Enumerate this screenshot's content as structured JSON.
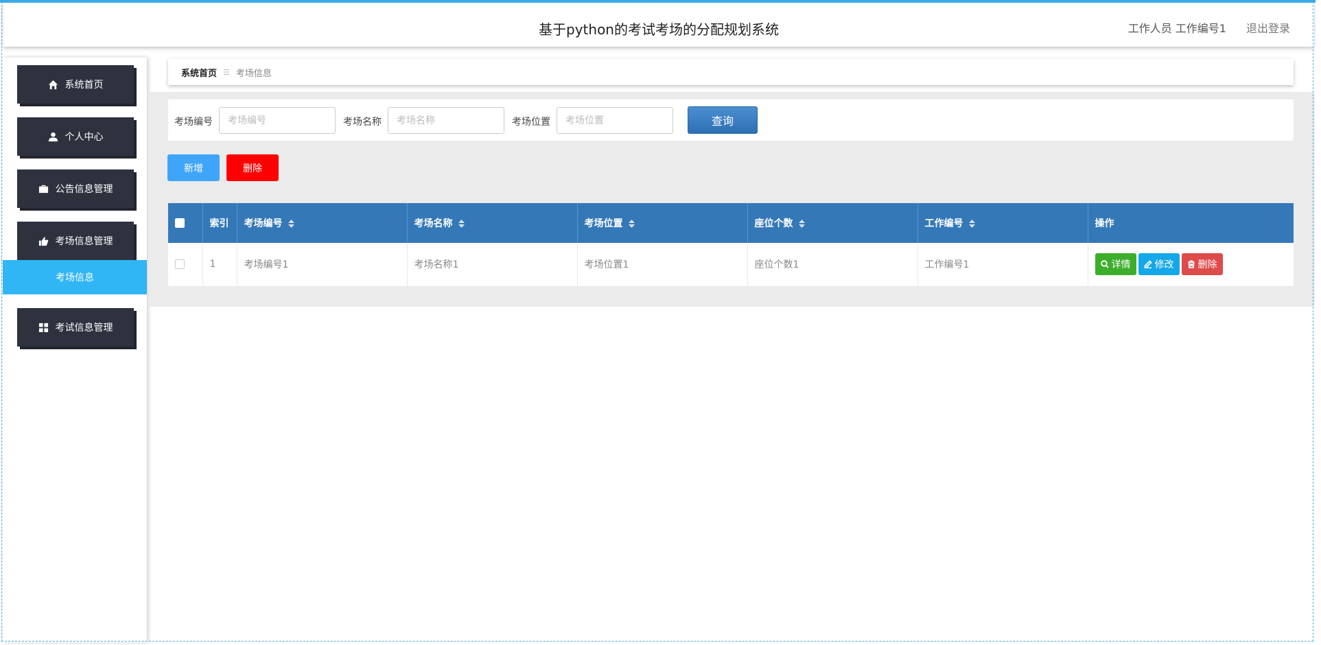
{
  "header": {
    "title": "基于python的考试考场的分配规划系统",
    "user": "工作人员 工作编号1",
    "logout": "退出登录"
  },
  "sidebar": {
    "items": [
      {
        "label": "系统首页",
        "icon": "home-icon"
      },
      {
        "label": "个人中心",
        "icon": "user-icon"
      },
      {
        "label": "公告信息管理",
        "icon": "briefcase-icon"
      },
      {
        "label": "考场信息管理",
        "icon": "hand-icon"
      },
      {
        "label": "考试信息管理",
        "icon": "grid-icon"
      }
    ],
    "active_sub": "考场信息"
  },
  "breadcrumb": {
    "home": "系统首页",
    "separator": "☰",
    "current": "考场信息"
  },
  "search": {
    "fields": [
      {
        "label": "考场编号",
        "placeholder": "考场编号",
        "value": ""
      },
      {
        "label": "考场名称",
        "placeholder": "考场名称",
        "value": ""
      },
      {
        "label": "考场位置",
        "placeholder": "考场位置",
        "value": ""
      }
    ],
    "query_label": "查询"
  },
  "actions": {
    "add": "新增",
    "delete": "删除"
  },
  "table": {
    "columns": [
      "索引",
      "考场编号",
      "考场名称",
      "考场位置",
      "座位个数",
      "工作编号",
      "操作"
    ],
    "rows": [
      {
        "index": "1",
        "code": "考场编号1",
        "name": "考场名称1",
        "location": "考场位置1",
        "seats": "座位个数1",
        "staff": "工作编号1"
      }
    ],
    "row_actions": {
      "detail": "详情",
      "edit": "修改",
      "delete": "删除"
    }
  },
  "colors": {
    "sidebar_button": "#2e323f",
    "active_sub": "#30b5f5",
    "table_header": "#3478b8",
    "add_button": "#3fa5fa",
    "delete_button": "#ff0000",
    "detail_button": "#3dae2b",
    "edit_button": "#14a8e8",
    "row_delete_button": "#de4b4b"
  }
}
